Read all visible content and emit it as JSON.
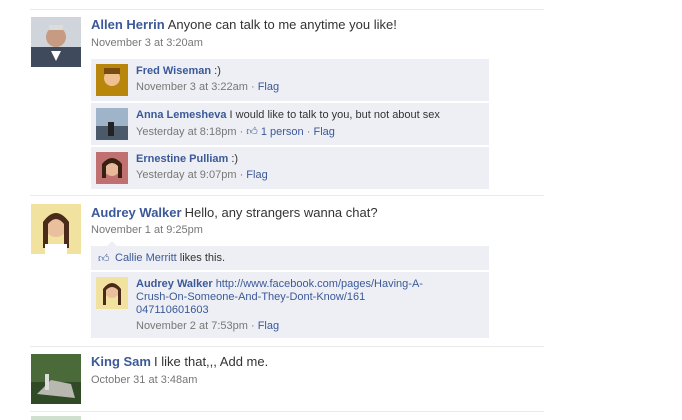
{
  "posts": [
    {
      "author": "Allen Herrin",
      "text": "Anyone can talk to me anytime you like!",
      "time": "November 3 at 3:20am",
      "replies": [
        {
          "author": "Fred Wiseman",
          "text": ":)",
          "time": "November 3 at 3:22am",
          "flag": "Flag"
        },
        {
          "author": "Anna Lemesheva",
          "text": "I would like to talk to you, but not about sex",
          "time": "Yesterday at 8:18pm",
          "likes": "1 person",
          "flag": "Flag"
        },
        {
          "author": "Ernestine Pulliam",
          "text": ":)",
          "time": "Yesterday at 9:07pm",
          "flag": "Flag"
        }
      ]
    },
    {
      "author": "Audrey Walker",
      "text": "Hello, any strangers wanna chat?",
      "time": "November 1 at 9:25pm",
      "like_name": "Callie Merritt",
      "like_suffix": "likes this.",
      "replies": [
        {
          "author": "Audrey Walker",
          "link_line1": "http://www.facebook.com/pages/Having-A-",
          "link_line2": "Crush-On-Someone-And-They-Dont-Know/161",
          "link_line3": "047110601603",
          "time": "November 2 at 7:53pm",
          "flag": "Flag"
        }
      ]
    },
    {
      "author": "King Sam",
      "text": "I like that,,, Add me.",
      "time": "October 31 at 3:48am"
    }
  ],
  "separator": "·",
  "colors": {
    "link": "#3b5998",
    "reply_bg": "#edeff4",
    "meta": "#777777"
  }
}
